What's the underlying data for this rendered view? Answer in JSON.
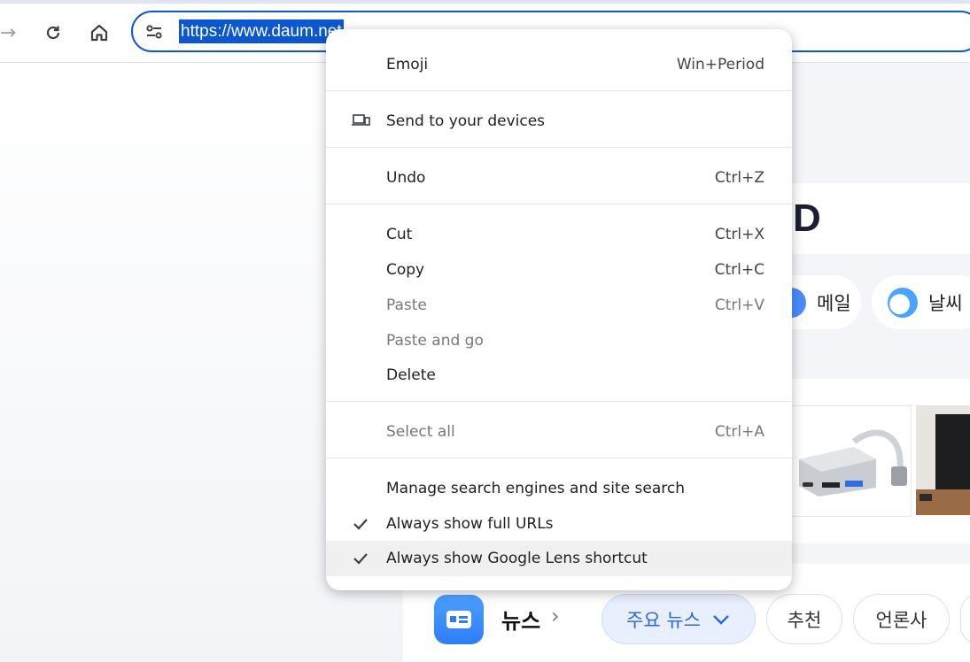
{
  "toolbar": {
    "forward_glyph": "→",
    "reload_glyph": "↻",
    "url": "https://www.daum.net"
  },
  "page": {
    "logo_letter": "D",
    "pills": [
      {
        "label": "메일",
        "icon": "mail-icon",
        "color": "#4a8cff"
      },
      {
        "label": "날씨",
        "icon": "weather-icon",
        "color": "#4aa3ff"
      }
    ],
    "news": {
      "title": "뉴스",
      "chevron": "›",
      "chips": [
        {
          "label": "주요 뉴스",
          "active": true
        },
        {
          "label": "추천",
          "active": false
        },
        {
          "label": "언론사",
          "active": false
        }
      ]
    }
  },
  "context_menu": {
    "items": [
      {
        "label": "Emoji",
        "shortcut": "Win+Period",
        "enabled": true
      },
      {
        "label": "Send to your devices",
        "shortcut": "",
        "enabled": true,
        "icon": "devices-icon"
      },
      {
        "label": "Undo",
        "shortcut": "Ctrl+Z",
        "enabled": true
      },
      {
        "label": "Cut",
        "shortcut": "Ctrl+X",
        "enabled": true
      },
      {
        "label": "Copy",
        "shortcut": "Ctrl+C",
        "enabled": true
      },
      {
        "label": "Paste",
        "shortcut": "Ctrl+V",
        "enabled": false
      },
      {
        "label": "Paste and go",
        "shortcut": "",
        "enabled": false
      },
      {
        "label": "Delete",
        "shortcut": "",
        "enabled": true
      },
      {
        "label": "Select all",
        "shortcut": "Ctrl+A",
        "enabled": false
      },
      {
        "label": "Manage search engines and site search",
        "shortcut": "",
        "enabled": true
      },
      {
        "label": "Always show full URLs",
        "shortcut": "",
        "enabled": true,
        "checked": true
      },
      {
        "label": "Always show Google Lens shortcut",
        "shortcut": "",
        "enabled": true,
        "checked": true,
        "highlighted": true
      }
    ]
  },
  "colors": {
    "accent": "#0b57d0",
    "chip_active_text": "#2b64e3"
  }
}
